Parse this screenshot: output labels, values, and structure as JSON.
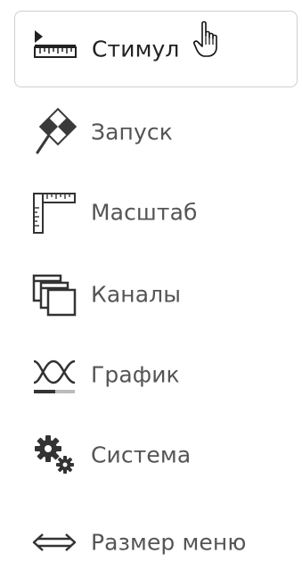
{
  "menu": {
    "items": [
      {
        "label": "Стимул",
        "icon": "stimulus-icon",
        "active": true
      },
      {
        "label": "Запуск",
        "icon": "launch-icon",
        "active": false
      },
      {
        "label": "Масштаб",
        "icon": "scale-icon",
        "active": false
      },
      {
        "label": "Каналы",
        "icon": "channels-icon",
        "active": false
      },
      {
        "label": "График",
        "icon": "graph-icon",
        "active": false
      },
      {
        "label": "Система",
        "icon": "system-icon",
        "active": false
      },
      {
        "label": "Размер меню",
        "icon": "resize-icon",
        "active": false
      }
    ]
  },
  "cursor": {
    "icon": "hand-pointer-icon"
  },
  "colors": {
    "icon": "#333333",
    "label": "#555555",
    "active_border": "#cfcfcf"
  }
}
